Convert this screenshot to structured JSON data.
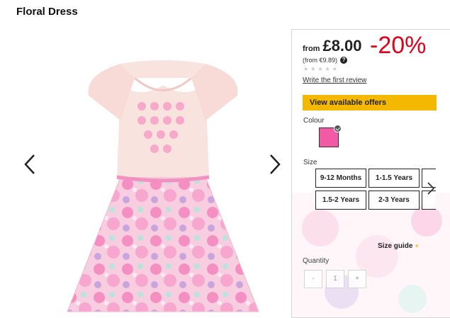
{
  "product": {
    "title": "Floral Dress"
  },
  "gallery": {
    "prev_icon": "chevron-left-icon",
    "next_icon": "chevron-right-icon"
  },
  "pricing": {
    "from_label": "from",
    "price": "£8.00",
    "discount": "-20%",
    "alt_price": "(from €9.89)",
    "help_icon": "?",
    "rating_stars": 0,
    "review_link": "Write the first review"
  },
  "offers": {
    "label": "View available offers",
    "color": "#f5b800"
  },
  "colour": {
    "label": "Colour",
    "selected_swatch": "#f25aa6"
  },
  "size": {
    "label": "Size",
    "options": [
      "9-12 Months",
      "1-1.5 Years",
      "",
      "1.5-2 Years",
      "2-3 Years",
      ""
    ],
    "next_icon": "chevron-right-icon",
    "guide_label": "Size guide",
    "guide_plus": "+"
  },
  "quantity": {
    "label": "Quantity",
    "minus": "-",
    "value": "1",
    "plus": "+"
  },
  "colors": {
    "accent": "#f5b800",
    "discount": "#e3001b"
  }
}
